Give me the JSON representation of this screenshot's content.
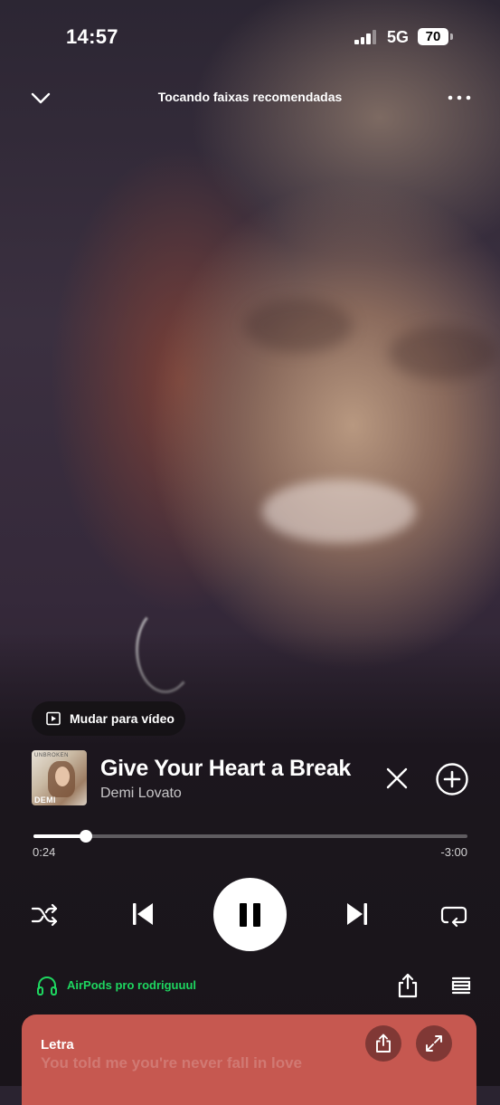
{
  "status_bar": {
    "time": "14:57",
    "network": "5G",
    "battery": "70"
  },
  "header": {
    "context_title": "Tocando faixas recomendadas",
    "collapse_icon": "chevron-down-icon",
    "more_icon": "more-horizontal-icon"
  },
  "video_switch": {
    "label": "Mudar para vídeo",
    "icon": "video-play-icon"
  },
  "track": {
    "title": "Give Your Heart a Break",
    "artist": "Demi Lovato",
    "album_art_top_text": "UNBROKEN",
    "album_art_bottom_text": "DEMI LOVATO"
  },
  "progress": {
    "elapsed": "0:24",
    "remaining": "-3:00",
    "fraction": 0.12
  },
  "controls": {
    "shuffle_icon": "shuffle-icon",
    "previous_icon": "skip-previous-icon",
    "play_state": "playing",
    "next_icon": "skip-next-icon",
    "repeat_icon": "repeat-icon"
  },
  "device": {
    "name": "AirPods pro rodriguuul",
    "color": "#1ed760"
  },
  "lyrics": {
    "title": "Letra",
    "preview_line": "You told me you're never fall in love",
    "background": "#c65850"
  }
}
